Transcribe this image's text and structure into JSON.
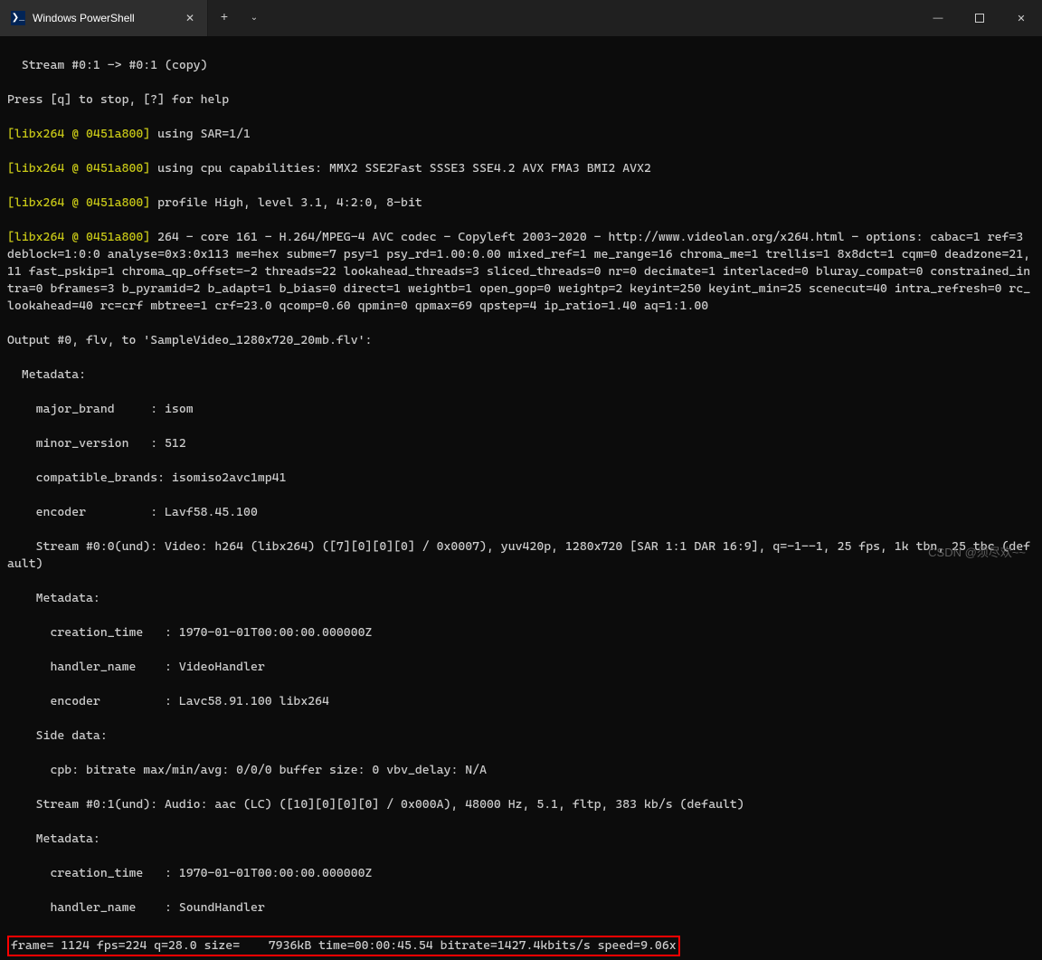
{
  "titlebar": {
    "tab_title": "Windows PowerShell",
    "icon_glyph": "❯_"
  },
  "terminal": {
    "line1": "  Stream #0:1 -> #0:1 (copy)",
    "line2": "Press [q] to stop, [?] for help",
    "libx264_prefix": "[libx264 @ 0451a800]",
    "libx264_msg1": " using SAR=1/1",
    "libx264_msg2": " using cpu capabilities: MMX2 SSE2Fast SSSE3 SSE4.2 AVX FMA3 BMI2 AVX2",
    "libx264_msg3": " profile High, level 3.1, 4:2:0, 8-bit",
    "libx264_msg4": " 264 - core 161 - H.264/MPEG-4 AVC codec - Copyleft 2003-2020 - http://www.videolan.org/x264.html - options: cabac=1 ref=3 deblock=1:0:0 analyse=0x3:0x113 me=hex subme=7 psy=1 psy_rd=1.00:0.00 mixed_ref=1 me_range=16 chroma_me=1 trellis=1 8x8dct=1 cqm=0 deadzone=21,11 fast_pskip=1 chroma_qp_offset=-2 threads=22 lookahead_threads=3 sliced_threads=0 nr=0 decimate=1 interlaced=0 bluray_compat=0 constrained_intra=0 bframes=3 b_pyramid=2 b_adapt=1 b_bias=0 direct=1 weightb=1 open_gop=0 weightp=2 keyint=250 keyint_min=25 scenecut=40 intra_refresh=0 rc_lookahead=40 rc=crf mbtree=1 crf=23.0 qcomp=0.60 qpmin=0 qpmax=69 qpstep=4 ip_ratio=1.40 aq=1:1.00",
    "output_line": "Output #0, flv, to 'SampleVideo_1280x720_20mb.flv':",
    "metadata_label": "  Metadata:",
    "major_brand": "    major_brand     : isom",
    "minor_version": "    minor_version   : 512",
    "compatible_brands": "    compatible_brands: isomiso2avc1mp41",
    "encoder": "    encoder         : Lavf58.45.100",
    "stream0": "    Stream #0:0(und): Video: h264 (libx264) ([7][0][0][0] / 0x0007), yuv420p, 1280x720 [SAR 1:1 DAR 16:9], q=-1--1, 25 fps, 1k tbn, 25 tbc (default)",
    "metadata_label2": "    Metadata:",
    "creation_time": "      creation_time   : 1970-01-01T00:00:00.000000Z",
    "handler_name_video": "      handler_name    : VideoHandler",
    "encoder2": "      encoder         : Lavc58.91.100 libx264",
    "side_data": "    Side data:",
    "cpb": "      cpb: bitrate max/min/avg: 0/0/0 buffer size: 0 vbv_delay: N/A",
    "stream1": "    Stream #0:1(und): Audio: aac (LC) ([10][0][0][0] / 0x000A), 48000 Hz, 5.1, fltp, 383 kb/s (default)",
    "metadata_label3": "    Metadata:",
    "creation_time2": "      creation_time   : 1970-01-01T00:00:00.000000Z",
    "handler_name_sound": "      handler_name    : SoundHandler",
    "progress": "frame= 1124 fps=224 q=28.0 size=    7936kB time=00:00:45.54 bitrate=1427.4kbits/s speed=9.06x"
  },
  "watermark": "CSDN @须尽欢~~"
}
